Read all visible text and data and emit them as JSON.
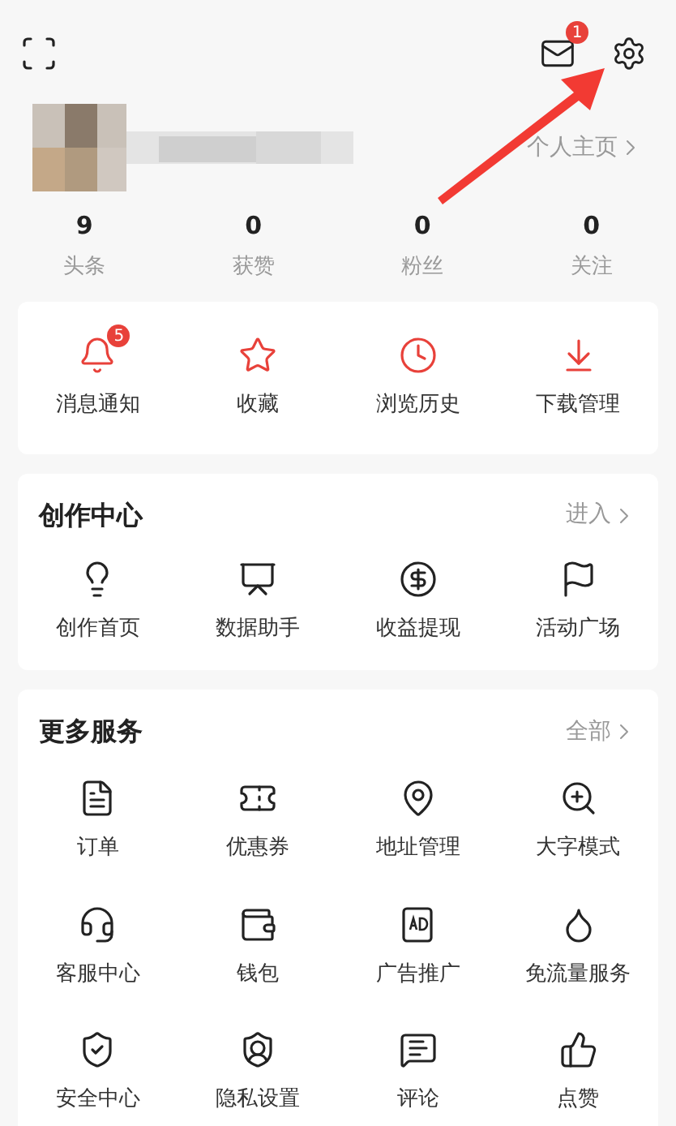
{
  "header": {
    "mail_badge": "1"
  },
  "profile": {
    "homepage_link": "个人主页"
  },
  "stats": [
    {
      "value": "9",
      "label": "头条"
    },
    {
      "value": "0",
      "label": "获赞"
    },
    {
      "value": "0",
      "label": "粉丝"
    },
    {
      "value": "0",
      "label": "关注"
    }
  ],
  "quick_actions": [
    {
      "label": "消息通知",
      "badge": "5"
    },
    {
      "label": "收藏"
    },
    {
      "label": "浏览历史"
    },
    {
      "label": "下载管理"
    }
  ],
  "creator_center": {
    "title": "创作中心",
    "link": "进入",
    "items": [
      "创作首页",
      "数据助手",
      "收益提现",
      "活动广场"
    ]
  },
  "more_services": {
    "title": "更多服务",
    "link": "全部",
    "items": [
      "订单",
      "优惠券",
      "地址管理",
      "大字模式",
      "客服中心",
      "钱包",
      "广告推广",
      "免流量服务",
      "安全中心",
      "隐私设置",
      "评论",
      "点赞"
    ]
  }
}
